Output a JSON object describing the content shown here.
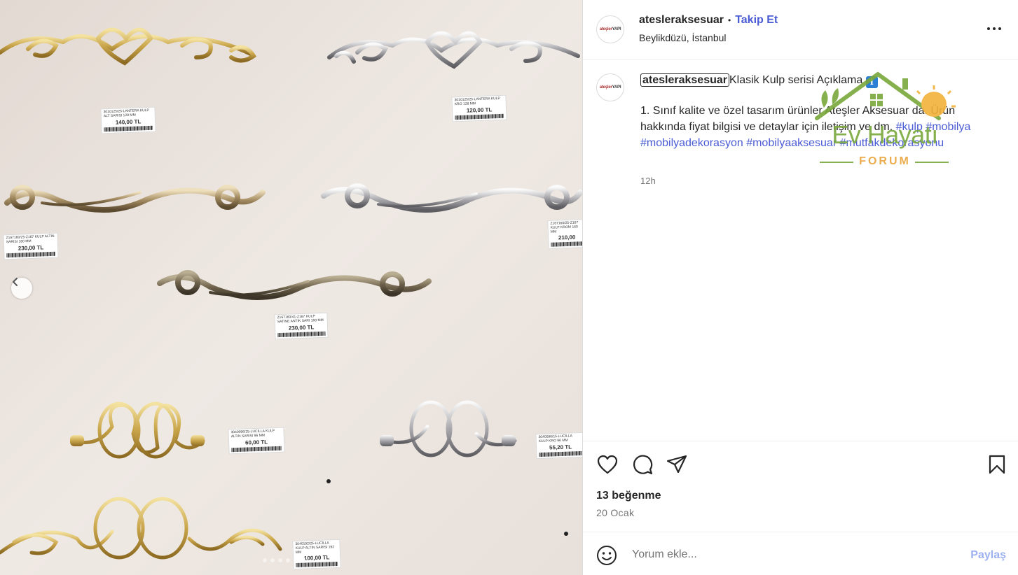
{
  "photo": {
    "tags": [
      {
        "desc": "3010125/25-LANTERA KULP ALT SARISI 128 MM",
        "price": "140,00 TL"
      },
      {
        "desc": "3010125/25-LANTERA KULP KRO 128 MM",
        "price": "120,00 TL"
      },
      {
        "desc": "Z167160/25-Z167 KULP ALTIN SARISI 160 MM",
        "price": "230,00 TL"
      },
      {
        "desc": "Z167160/25-Z167 KULP KROM 160 MM",
        "price": "210,00"
      },
      {
        "desc": "Z167160/41-Z167 KULP SATINE ANTİK SARI 160 MM",
        "price": "230,00 TL"
      },
      {
        "desc": "3040096/25-LUCİLLA KULP ALTIN SARISI 96 MM",
        "price": "60,00 TL"
      },
      {
        "desc": "3040096/15-LUCİLLA KULP KRO 96 MM",
        "price": "55,20 TL"
      },
      {
        "desc": "3040192/25-LUCİLLA KULP ALTIN SARISI 192 MM",
        "price": "100,00 TL"
      }
    ],
    "prev_icon": "chevron-left-icon",
    "slide_count": 6,
    "active_slide": 6
  },
  "header": {
    "avatar_text_a": "ateşler",
    "avatar_text_b": "YAPI",
    "username": "atesleraksesuar",
    "separator": "•",
    "follow_label": "Takip Et",
    "location": "Beylikdüzü, İstanbul",
    "more_icon": "more-horizontal-icon"
  },
  "caption": {
    "username": "atesleraksesuar",
    "title": "Klasik Kulp serisi Açıklama",
    "emoji": "ℹ",
    "body": "1. Sınıf kalite ve özel tasarım ürünler Ateşler Aksesuar da. Ürün hakkında fiyat bilgisi ve detaylar için iletişim ve dm.",
    "hashtags": [
      "#kulp",
      "#mobilya",
      "#mobilyadekorasyon",
      "#mobilyaaksesuar",
      "#mutfakdekorasyonu"
    ],
    "time_ago": "12h"
  },
  "watermark": {
    "line1": "Ev Hayatı",
    "line2": "FORUM"
  },
  "actions": {
    "like_icon": "heart-icon",
    "comment_icon": "comment-icon",
    "share_icon": "send-icon",
    "save_icon": "bookmark-icon"
  },
  "stats": {
    "likes": "13 beğenme",
    "date": "20 Ocak"
  },
  "comment": {
    "emoji_icon": "emoji-icon",
    "placeholder": "Yorum ekle...",
    "share_label": "Paylaş"
  },
  "colors": {
    "accent": "#4a5bd4",
    "share_disabled": "#9db0ef",
    "muted": "#737373",
    "wall": "#ece5df"
  }
}
